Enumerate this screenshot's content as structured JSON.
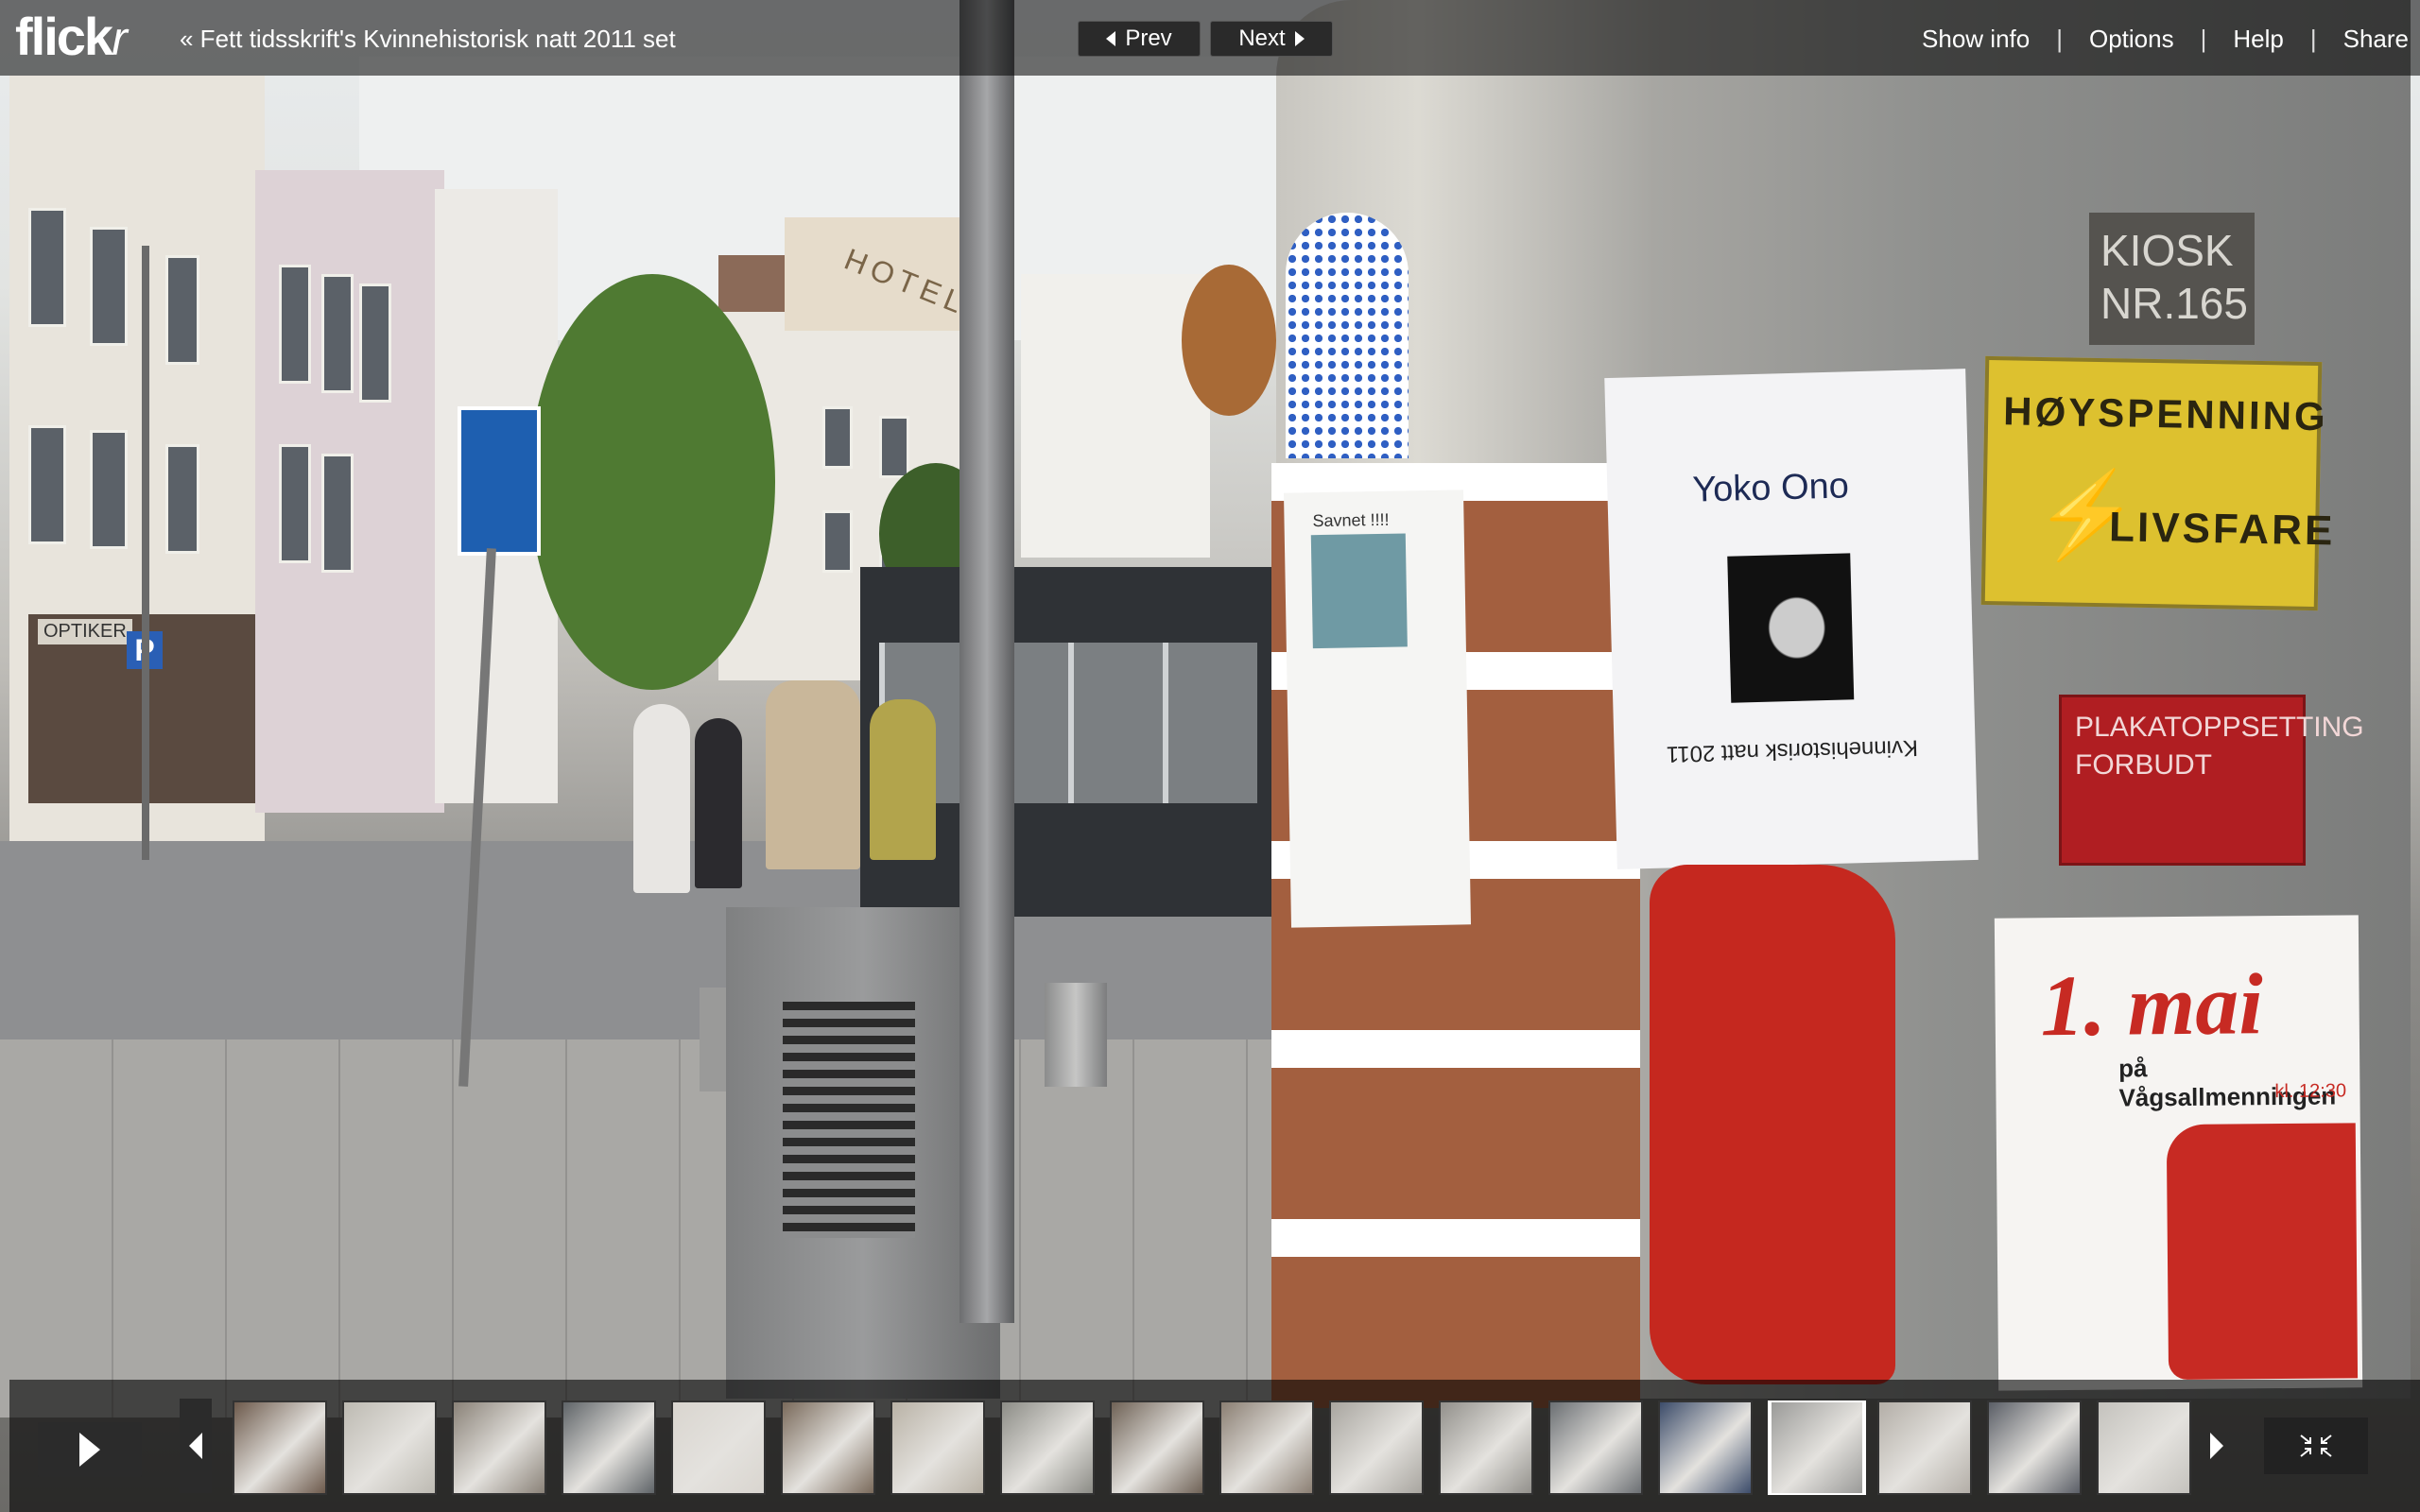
{
  "header": {
    "logo_text": "flick",
    "logo_r": "r",
    "set_link": "« Fett tidsskrift's Kvinnehistorisk natt 2011 set",
    "prev_label": "Prev",
    "next_label": "Next",
    "menu": [
      "Show info",
      "Options",
      "Help",
      "Share"
    ],
    "menu_separator": "|"
  },
  "photo": {
    "poster_yoko_title": "Yoko Ono",
    "poster_yoko_caption": "Kvinnehistorisk natt 2011",
    "sign_kiosk": "KIOSK NR.165",
    "sign_hoyspenning_top": "HØYSPENNING",
    "sign_hoyspenning_bottom": "LIVSFARE",
    "sign_plakat": "PLAKATOPPSETTING FORBUDT",
    "poster_mai": "1. mai",
    "poster_mai_sub": "på Vågsallmenningen",
    "poster_mai_time": "kl. 12:30",
    "poster_savnet": "Savnet !!!!",
    "hotel_sign": "HOTEL",
    "shop_sign": "OPTIKER",
    "parking_sign": "P"
  },
  "filmstrip": {
    "thumb_count": 18,
    "selected_index": 14,
    "thumb_colors": [
      "#6d5a4c",
      "#bdbab2",
      "#8a8278",
      "#5f6468",
      "#d9d5cf",
      "#7a6a5b",
      "#b9b2a6",
      "#8c8c86",
      "#6f6256",
      "#8b7f73",
      "#a8a59f",
      "#92908b",
      "#6b6f73",
      "#3c4c6a",
      "#9a9a98",
      "#b3aea7",
      "#5a5e66",
      "#c4c2bd"
    ]
  },
  "colors": {
    "topbar_bg": "rgba(0,0,0,0.55)",
    "yellow_sign": "#e0c22c",
    "red_sign": "#b51f22",
    "poster_red": "#c72a23"
  }
}
